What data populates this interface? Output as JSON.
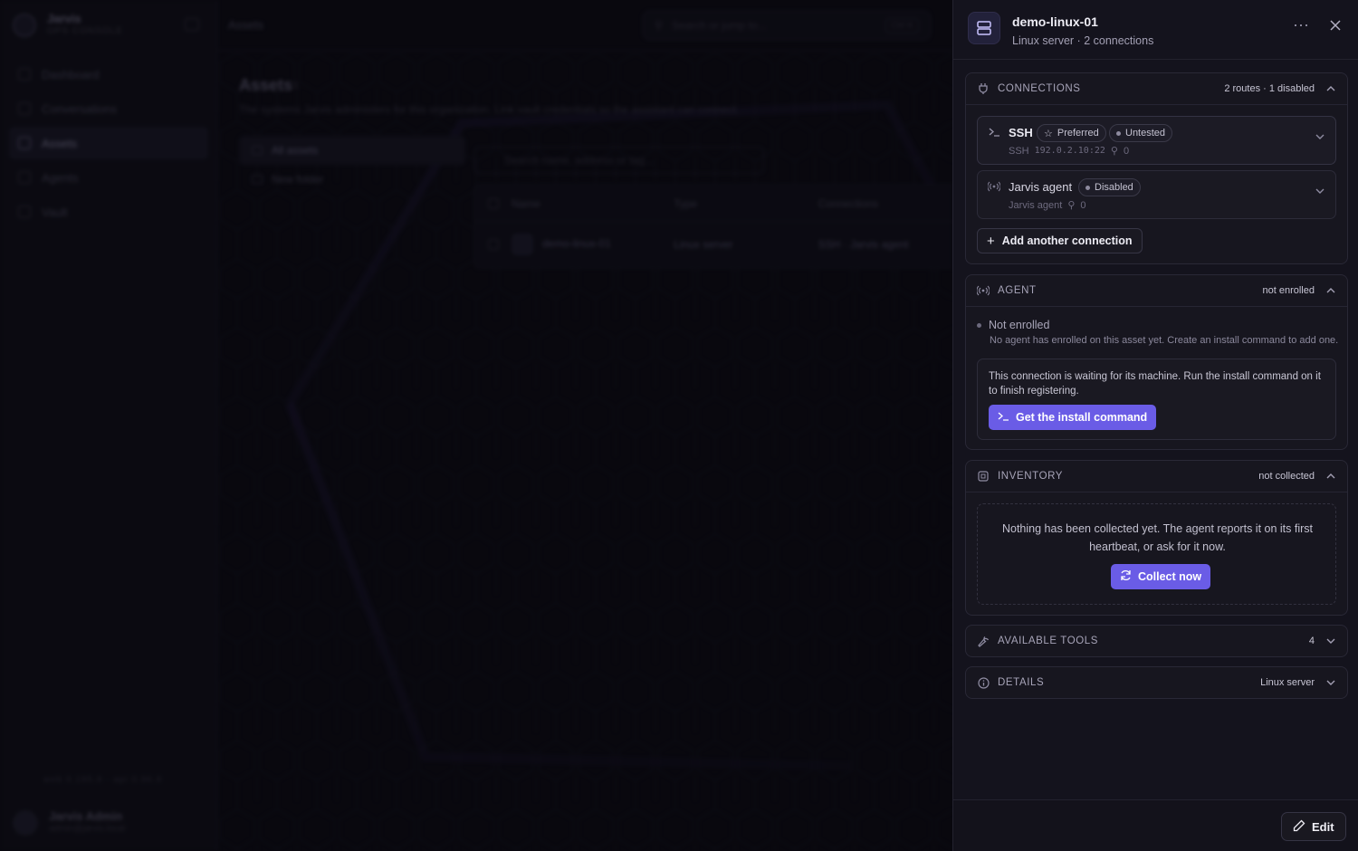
{
  "background": {
    "brand": {
      "name": "Jarvis",
      "subtitle": "OPS CONSOLE"
    },
    "nav": [
      {
        "label": "Dashboard",
        "icon": "dashboard-icon",
        "active": false
      },
      {
        "label": "Conversations",
        "icon": "chat-icon",
        "active": false
      },
      {
        "label": "Assets",
        "icon": "server-icon",
        "active": true
      },
      {
        "label": "Agents",
        "icon": "agent-icon",
        "active": false
      },
      {
        "label": "Vault",
        "icon": "key-icon",
        "active": false
      }
    ],
    "version": "web 0.195.8 · api 0.96.8",
    "user": {
      "name": "Jarvis Admin",
      "email": "admin@jarvis.local"
    },
    "topbar_title": "Assets",
    "search_placeholder": "Search or jump to...",
    "search_shortcut": "Ctrl K",
    "page": {
      "title": "Assets",
      "count": "1",
      "subtitle": "The systems Jarvis administers for this organization. Link vault credentials so the assistant can connect.",
      "folders": [
        "All assets",
        "New folder"
      ],
      "asset_search_placeholder": "Search name, address or tag...",
      "columns": [
        "Name",
        "Type",
        "Connections"
      ],
      "row": {
        "name": "demo-linux-01",
        "sub": "Default host",
        "type": "Linux server",
        "conn": "SSH · Jarvis agent"
      }
    }
  },
  "drawer": {
    "title": "demo-linux-01",
    "subtitle": "Linux server · 2 connections",
    "connections": {
      "title": "CONNECTIONS",
      "meta": "2 routes · 1 disabled",
      "items": [
        {
          "name": "SSH",
          "badges": [
            "Preferred",
            "Untested"
          ],
          "protocol": "SSH",
          "address": "192.0.2.10:22",
          "keys": "0"
        },
        {
          "name": "Jarvis agent",
          "badges": [
            "Disabled"
          ],
          "protocol": "Jarvis agent",
          "address": "",
          "keys": "0"
        }
      ],
      "add_label": "Add another connection"
    },
    "agent": {
      "title": "AGENT",
      "meta": "not enrolled",
      "status": "Not enrolled",
      "description": "No agent has enrolled on this asset yet. Create an install command to add one.",
      "wait_text": "This connection is waiting for its machine. Run the install command on it to finish registering.",
      "button": "Get the install command"
    },
    "inventory": {
      "title": "INVENTORY",
      "meta": "not collected",
      "empty_text": "Nothing has been collected yet. The agent reports it on its first heartbeat, or ask for it now.",
      "button": "Collect now"
    },
    "tools": {
      "title": "AVAILABLE TOOLS",
      "meta": "4"
    },
    "details": {
      "title": "DETAILS",
      "meta": "Linux server"
    },
    "edit_label": "Edit"
  },
  "colors": {
    "accent": "#6a5ce6",
    "panel": "#14131d",
    "card": "#17161f"
  }
}
